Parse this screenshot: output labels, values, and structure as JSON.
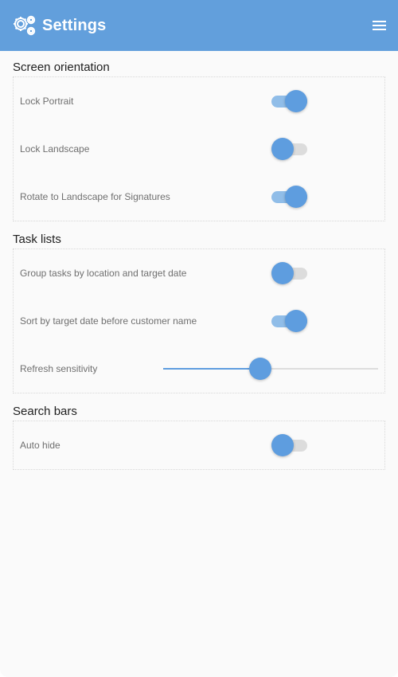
{
  "header": {
    "title": "Settings",
    "icon": "settings-gears-icon",
    "menu_icon": "hamburger-menu-icon",
    "background": "#629fdc"
  },
  "colors": {
    "accent": "#5e9ddf",
    "track_on": "#90bde8",
    "track_off": "#dcdcdc"
  },
  "sections": [
    {
      "title": "Screen orientation",
      "items": [
        {
          "label": "Lock Portrait",
          "type": "toggle",
          "value": true
        },
        {
          "label": "Lock Landscape",
          "type": "toggle",
          "value": false
        },
        {
          "label": "Rotate to Landscape for Signatures",
          "type": "toggle",
          "value": true
        }
      ]
    },
    {
      "title": "Task lists",
      "items": [
        {
          "label": "Group tasks by location and target date",
          "type": "toggle",
          "value": false
        },
        {
          "label": "Sort by target date before customer name",
          "type": "toggle",
          "value": true
        },
        {
          "label": "Refresh sensitivity",
          "type": "slider",
          "value": 0.45
        }
      ]
    },
    {
      "title": "Search bars",
      "items": [
        {
          "label": "Auto hide",
          "type": "toggle",
          "value": false
        }
      ]
    }
  ]
}
